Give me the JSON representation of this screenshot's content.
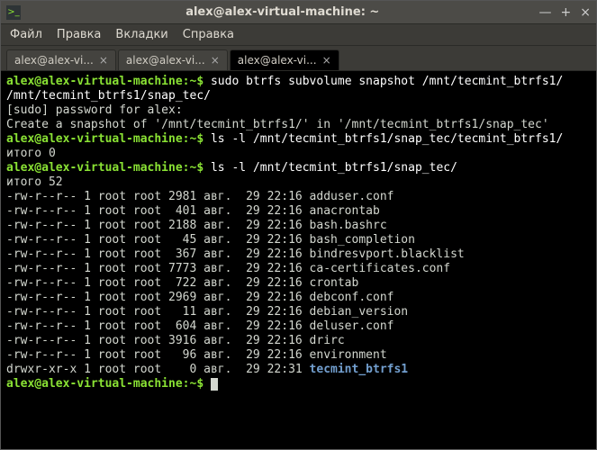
{
  "window": {
    "title": "alex@alex-virtual-machine: ~",
    "min": "—",
    "max": "+",
    "close": "×"
  },
  "menu": {
    "file": "Файл",
    "edit": "Правка",
    "tabs": "Вкладки",
    "help": "Справка"
  },
  "tabs": [
    {
      "label": "alex@alex-vi..."
    },
    {
      "label": "alex@alex-vi..."
    },
    {
      "label": "alex@alex-vi...",
      "active": true
    }
  ],
  "term": {
    "prompt": "alex@alex-virtual-machine:~$",
    "cmd1_a": "sudo btrfs subvolume snapshot /mnt/tecmint_btrfs1/",
    "cmd1_b": "/mnt/tecmint_btrfs1/snap_tec/",
    "sudo_line": "[sudo] password for alex:",
    "snap_line": "Create a snapshot of '/mnt/tecmint_btrfs1/' in '/mnt/tecmint_btrfs1/snap_tec'",
    "cmd2": "ls -l /mnt/tecmint_btrfs1/snap_tec/tecmint_btrfs1/",
    "total0": "итого 0",
    "cmd3": "ls -l /mnt/tecmint_btrfs1/snap_tec/",
    "total52": "итого 52",
    "lines": [
      "-rw-r--r-- 1 root root 2981 авг.  29 22:16 adduser.conf",
      "-rw-r--r-- 1 root root  401 авг.  29 22:16 anacrontab",
      "-rw-r--r-- 1 root root 2188 авг.  29 22:16 bash.bashrc",
      "-rw-r--r-- 1 root root   45 авг.  29 22:16 bash_completion",
      "-rw-r--r-- 1 root root  367 авг.  29 22:16 bindresvport.blacklist",
      "-rw-r--r-- 1 root root 7773 авг.  29 22:16 ca-certificates.conf",
      "-rw-r--r-- 1 root root  722 авг.  29 22:16 crontab",
      "-rw-r--r-- 1 root root 2969 авг.  29 22:16 debconf.conf",
      "-rw-r--r-- 1 root root   11 авг.  29 22:16 debian_version",
      "-rw-r--r-- 1 root root  604 авг.  29 22:16 deluser.conf",
      "-rw-r--r-- 1 root root 3916 авг.  29 22:16 drirc",
      "-rw-r--r-- 1 root root   96 авг.  29 22:16 environment"
    ],
    "dirline_prefix": "drwxr-xr-x 1 root root    0 авг.  29 22:31 ",
    "dirline_name": "tecmint_btrfs1"
  }
}
